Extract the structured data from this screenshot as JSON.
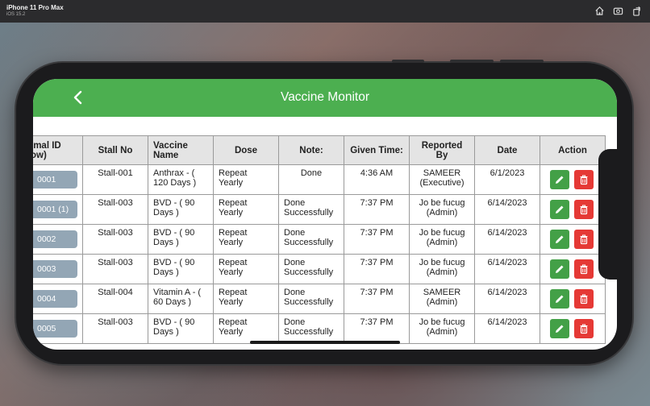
{
  "simulator": {
    "device": "iPhone 11 Pro Max",
    "os": "iOS 15.2",
    "icons": [
      "home-icon",
      "screenshot-icon",
      "rotate-icon"
    ]
  },
  "app": {
    "title": "Vaccine Monitor",
    "accent": "#4caf50"
  },
  "table": {
    "headers": {
      "animal_id": "imal ID",
      "animal_id_2": "ow)",
      "stall_no": "Stall No",
      "vaccine_name": "Vaccine Name",
      "dose": "Dose",
      "note": "Note:",
      "given_time": "Given Time:",
      "reported_by": "Reported By",
      "date": "Date",
      "action": "Action"
    },
    "rows": [
      {
        "id": "0001",
        "stall": "Stall-001",
        "vaccine": "Anthrax - ( 120 Days )",
        "dose": "Repeat Yearly",
        "note": "Done",
        "time": "4:36 AM",
        "reported": "SAMEER (Executive)",
        "date": "6/1/2023"
      },
      {
        "id": "0001 (1)",
        "stall": "Stall-003",
        "vaccine": "BVD - ( 90 Days )",
        "dose": "Repeat Yearly",
        "note": "Done Successfully",
        "time": "7:37 PM",
        "reported": "Jo be fucug (Admin)",
        "date": "6/14/2023"
      },
      {
        "id": "0002",
        "stall": "Stall-003",
        "vaccine": "BVD - ( 90 Days )",
        "dose": "Repeat Yearly",
        "note": "Done Successfully",
        "time": "7:37 PM",
        "reported": "Jo be fucug (Admin)",
        "date": "6/14/2023"
      },
      {
        "id": "0003",
        "stall": "Stall-003",
        "vaccine": "BVD - ( 90 Days )",
        "dose": "Repeat Yearly",
        "note": "Done Successfully",
        "time": "7:37 PM",
        "reported": "Jo be fucug (Admin)",
        "date": "6/14/2023"
      },
      {
        "id": "0004",
        "stall": "Stall-004",
        "vaccine": "Vitamin A - ( 60 Days )",
        "dose": "Repeat Yearly",
        "note": "Done Successfully",
        "time": "7:37 PM",
        "reported": "SAMEER (Admin)",
        "date": "6/14/2023"
      },
      {
        "id": "0005",
        "stall": "Stall-003",
        "vaccine": "BVD - ( 90 Days )",
        "dose": "Repeat Yearly",
        "note": "Done Successfully",
        "time": "7:37 PM",
        "reported": "Jo be fucug (Admin)",
        "date": "6/14/2023"
      }
    ],
    "action_icons": [
      "pencil-icon",
      "trash-icon"
    ]
  }
}
